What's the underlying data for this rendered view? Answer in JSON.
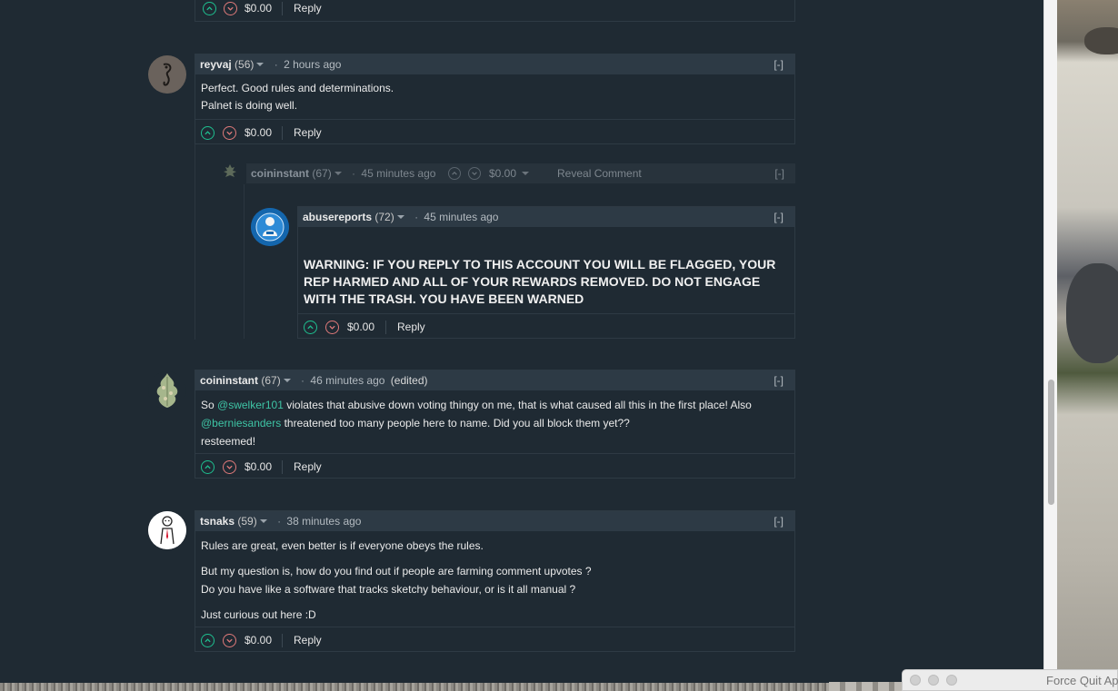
{
  "comments": {
    "top": {
      "payout": "$0.00",
      "reply": "Reply"
    },
    "reyvaj": {
      "author": "reyvaj",
      "rep": "(56)",
      "time": "2 hours ago",
      "collapse": "[-]",
      "lines": [
        "Perfect. Good rules and determinations.",
        "Palnet is doing well."
      ],
      "payout": "$0.00",
      "reply": "Reply"
    },
    "coininstant_hidden": {
      "author": "coininstant",
      "rep": "(67)",
      "time": "45 minutes ago",
      "payout": "$0.00",
      "reveal": "Reveal Comment",
      "collapse": "[-]"
    },
    "abusereports": {
      "author": "abusereports",
      "rep": "(72)",
      "time": "45 minutes ago",
      "collapse": "[-]",
      "warning": "WARNING: IF YOU REPLY TO THIS ACCOUNT YOU WILL BE FLAGGED, YOUR REP HARMED AND ALL OF YOUR REWARDS REMOVED. DO NOT ENGAGE WITH THE TRASH. YOU HAVE BEEN WARNED",
      "payout": "$0.00",
      "reply": "Reply"
    },
    "coininstant": {
      "author": "coininstant",
      "rep": "(67)",
      "time": "46 minutes ago",
      "edited": "(edited)",
      "collapse": "[-]",
      "line1_a": "So ",
      "mention1": "@swelker101",
      "line1_b": " violates that abusive down voting thingy on me, that is what caused all this in the first place! Also",
      "mention2": "@berniesanders",
      "line2_b": " threatened too many people here to name. Did you all block them yet??",
      "line3": "resteemed!",
      "payout": "$0.00",
      "reply": "Reply"
    },
    "tsnaks": {
      "author": "tsnaks",
      "rep": "(59)",
      "time": "38 minutes ago",
      "collapse": "[-]",
      "p1": "Rules are great, even better is if everyone obeys the rules.",
      "p2a": "But my question is, how do you find out if people are farming comment upvotes ?",
      "p2b": "Do you have like a software that tracks sketchy behaviour, or is it all manual ?",
      "p3": "Just curious out here :D",
      "payout": "$0.00",
      "reply": "Reply"
    }
  },
  "system": {
    "force_quit_title": "Force Quit Ap"
  },
  "colors": {
    "background": "#1f2a33",
    "header": "#2d3a45",
    "mention": "#3ec4a5",
    "upvote": "#1fbf8f",
    "downvote": "#e07a7a"
  }
}
